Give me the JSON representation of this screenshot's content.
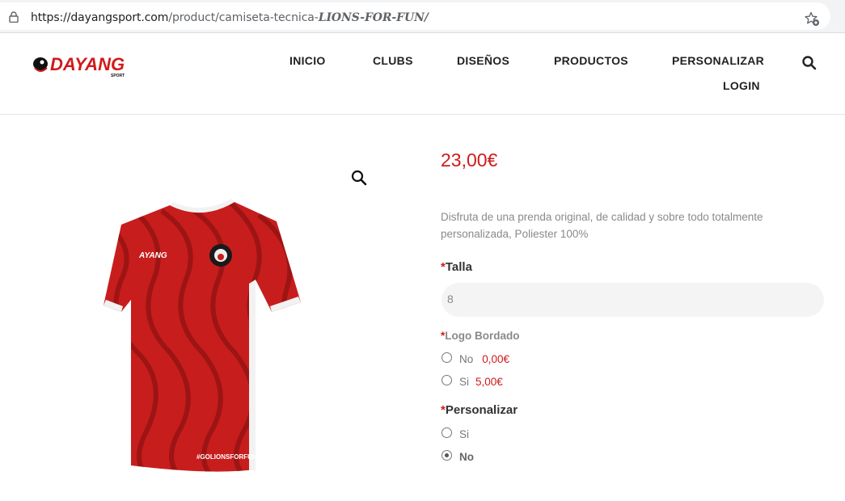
{
  "browser": {
    "url_host": "https://dayangsport.com",
    "url_path": "/product/camiseta-tecnica-",
    "url_tail": "LIONS-FOR-FUN/"
  },
  "header": {
    "logo_text": "DAYANG",
    "logo_sub": "SPORT",
    "nav": [
      "INICIO",
      "CLUBS",
      "DISEÑOS",
      "PRODUCTOS",
      "PERSONALIZAR",
      "LOGIN"
    ]
  },
  "product": {
    "brand_on_shirt": "AYANG",
    "hashtag": "#GOLIONSFORFUN",
    "price": "23,00€",
    "description": "Disfruta de una prenda original, de calidad y sobre todo totalmente personalizada, Poliester 100%",
    "required_mark": "*",
    "talla": {
      "label": "Talla",
      "selected": "8"
    },
    "logo_bordado": {
      "label": "Logo Bordado",
      "options": [
        {
          "text": "No",
          "price": "0,00€",
          "checked": false
        },
        {
          "text": "Si",
          "price": "5,00€",
          "checked": false
        }
      ]
    },
    "personalizar": {
      "label": "Personalizar",
      "options": [
        {
          "text": "Si",
          "checked": false
        },
        {
          "text": "No",
          "checked": true
        }
      ]
    }
  },
  "colors": {
    "accent": "#d11a1a",
    "shirt": "#c81d1d",
    "shirt_dark": "#8f1212"
  },
  "icons": [
    "lock-icon",
    "star-add-icon",
    "search-icon",
    "zoom-icon"
  ]
}
